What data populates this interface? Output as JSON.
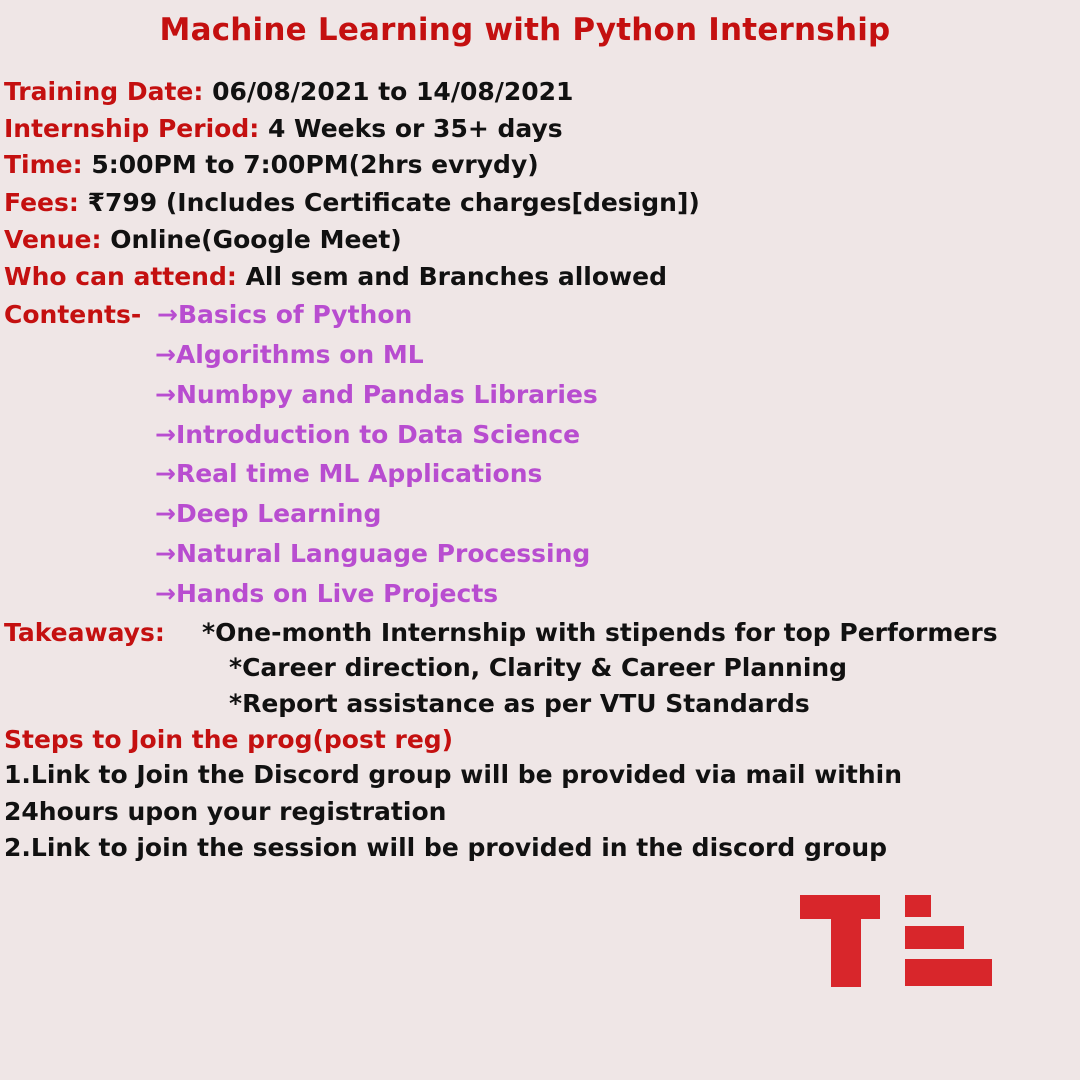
{
  "title": "Machine Learning with Python Internship",
  "details": [
    {
      "label": "Training Date:",
      "value": " 06/08/2021 to 14/08/2021"
    },
    {
      "label": "Internship Period:",
      "value": " 4 Weeks or 35+ days"
    },
    {
      "label": "Time:",
      "value": " 5:00PM to 7:00PM(2hrs evrydy)"
    },
    {
      "label": "Fees:",
      "value": " ₹799 (Includes Certificate charges[design])"
    },
    {
      "label": "Venue:",
      "value": " Online(Google Meet)"
    },
    {
      "label": "Who can attend:",
      "value": " All sem and Branches allowed"
    }
  ],
  "contents": {
    "label": "Contents-",
    "items": [
      "→Basics of Python",
      "→Algorithms on ML",
      "→Numbpy and Pandas Libraries",
      "→Introduction to Data Science",
      "→Real time ML Applications",
      "→Deep Learning",
      "→Natural Language Processing",
      "→Hands on Live Projects"
    ]
  },
  "takeaways": {
    "label": "Takeaways:",
    "items": [
      "*One-month Internship with stipends for top Performers",
      "*Career direction, Clarity & Career Planning",
      "*Report assistance as per VTU Standards"
    ]
  },
  "steps": {
    "label": "Steps to Join the prog(post reg)",
    "lines": [
      "1.Link to Join the Discord group will be provided via mail within",
      "24hours upon your registration",
      "2.Link to join the session will be provided in the discord group"
    ]
  },
  "colors": {
    "label_red": "#c41010",
    "content_purple": "#b84dd0",
    "background": "#efe6e6",
    "logo_red": "#d8262b"
  },
  "logo": {
    "icon": "tl-logo-icon",
    "text": "TL"
  }
}
